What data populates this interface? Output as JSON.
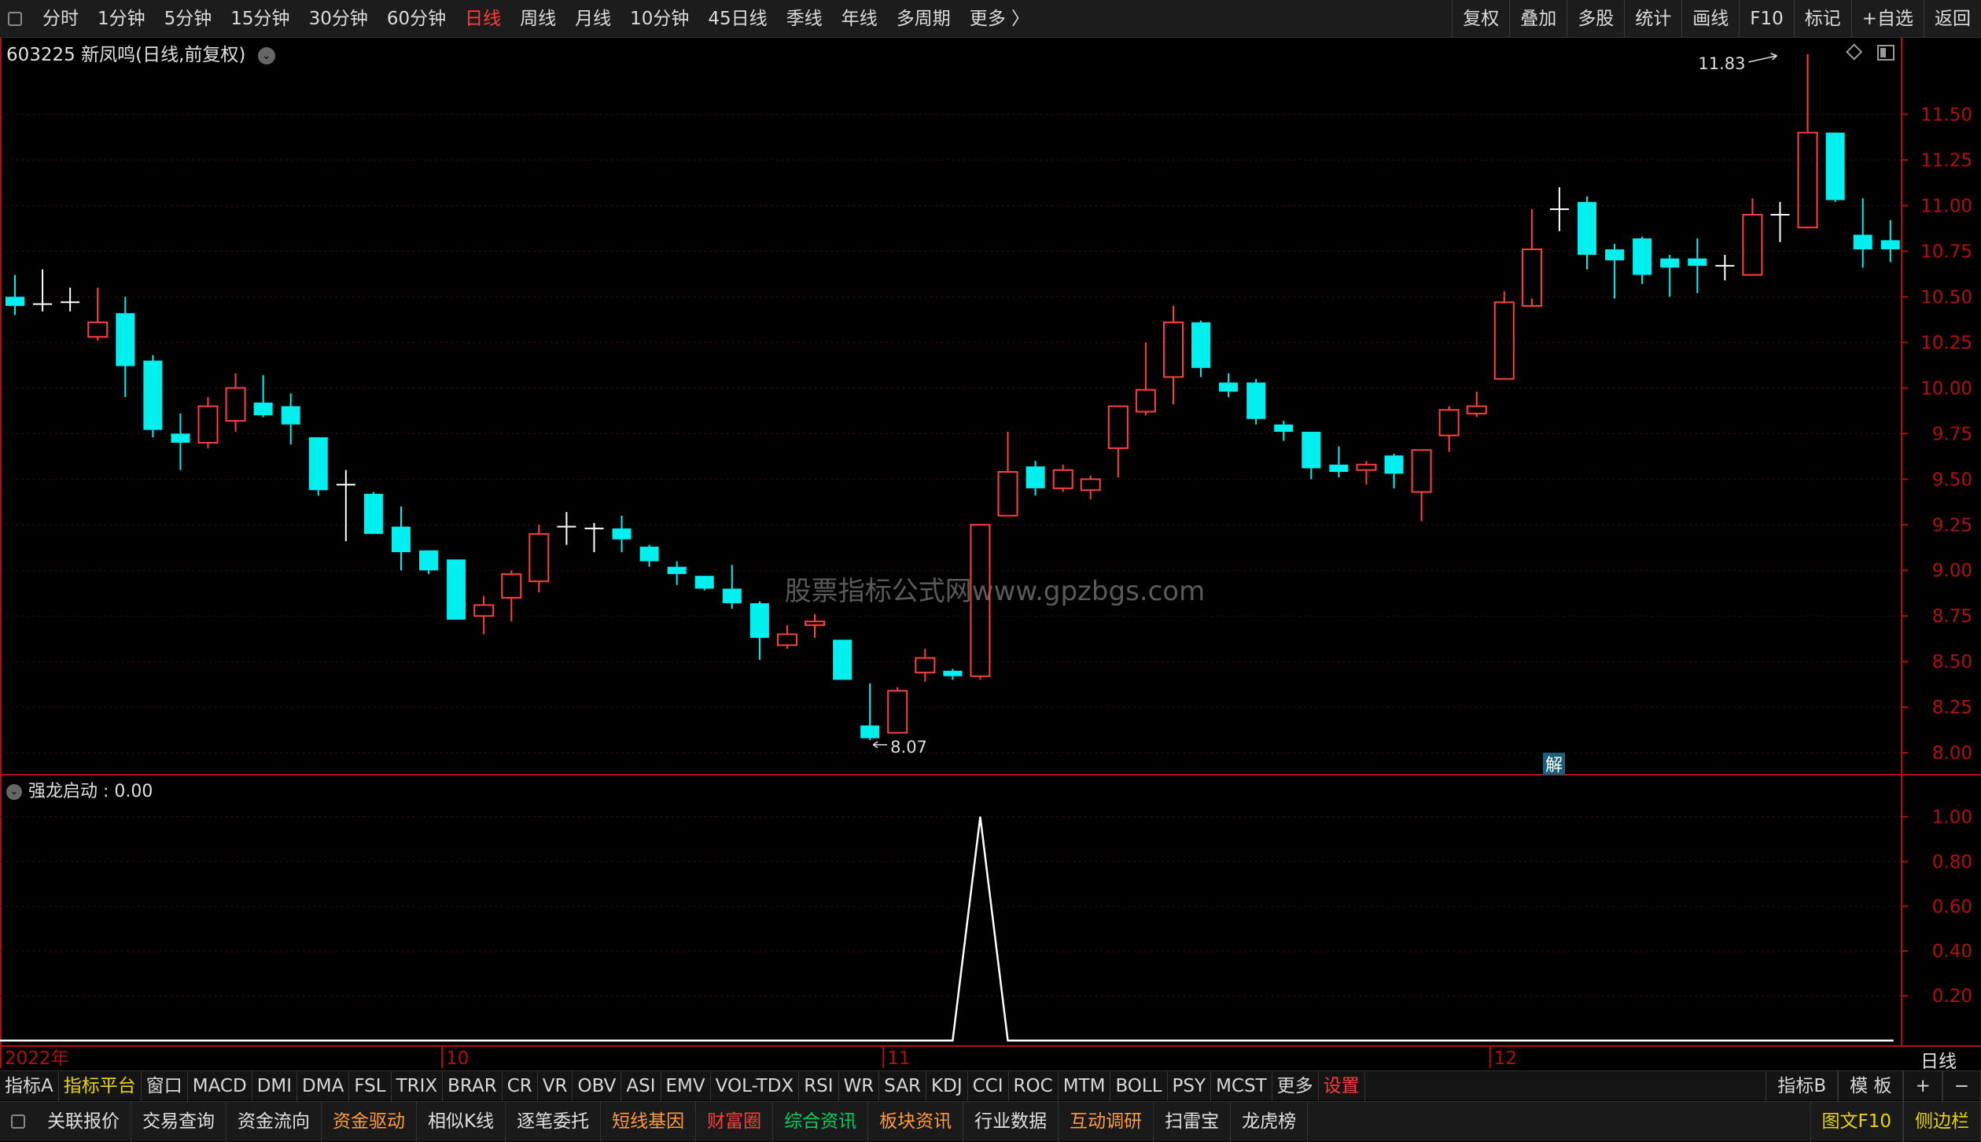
{
  "topbar": {
    "periods": [
      "分时",
      "1分钟",
      "5分钟",
      "15分钟",
      "30分钟",
      "60分钟",
      "日线",
      "周线",
      "月线",
      "10分钟",
      "45日线",
      "季线",
      "年线",
      "多周期",
      "更多 〉"
    ],
    "active_index": 6,
    "tools": [
      "复权",
      "叠加",
      "多股",
      "统计",
      "画线",
      "F10",
      "标记",
      "+自选",
      "返回"
    ]
  },
  "stock": {
    "code": "603225",
    "name": "新凤鸣",
    "mode": "(日线,前复权)"
  },
  "watermark": "股票指标公式网www.gpzbgs.com",
  "jie_marker": "解",
  "indicator": {
    "name": "强龙启动",
    "value_text": "0.00",
    "yticks": [
      "1.00",
      "0.80",
      "0.60",
      "0.40",
      "0.20"
    ]
  },
  "period_label": "日线",
  "x_labels": [
    {
      "i": 0,
      "text": "2022年"
    },
    {
      "i": 16,
      "text": "10"
    },
    {
      "i": 32,
      "text": "11"
    },
    {
      "i": 54,
      "text": "12"
    }
  ],
  "tabs": [
    "指标A",
    "指标平台",
    "窗口",
    "MACD",
    "DMI",
    "DMA",
    "FSL",
    "TRIX",
    "BRAR",
    "CR",
    "VR",
    "OBV",
    "ASI",
    "EMV",
    "VOL-TDX",
    "RSI",
    "WR",
    "SAR",
    "KDJ",
    "CCI",
    "ROC",
    "MTM",
    "BOLL",
    "PSY",
    "MCST",
    "更多",
    "设置"
  ],
  "tabs_right": [
    "指标B",
    "模 板",
    "+",
    "−"
  ],
  "functions": [
    "关联报价",
    "交易查询",
    "资金流向",
    "资金驱动",
    "相似K线",
    "逐笔委托",
    "短线基因",
    "财富圈",
    "综合资讯",
    "板块资讯",
    "行业数据",
    "互动调研",
    "扫雷宝",
    "龙虎榜"
  ],
  "functions_right": [
    "图文F10",
    "侧边栏"
  ],
  "colors": {
    "up": "#ff4040",
    "down": "#00f0f0",
    "flat": "#ffffff",
    "axis": "#b01010"
  },
  "chart_data": {
    "type": "candlestick",
    "title": "603225 新凤鸣 (日线,前复权)",
    "y_ticks": [
      8.0,
      8.25,
      8.5,
      8.75,
      9.0,
      9.25,
      9.5,
      9.75,
      10.0,
      10.25,
      10.5,
      10.75,
      11.0,
      11.25,
      11.5
    ],
    "ylim": [
      7.88,
      11.92
    ],
    "annotations": [
      {
        "i": 31,
        "value": 8.07,
        "text": "8.07"
      },
      {
        "i": 64,
        "value": 11.83,
        "text": "11.83"
      }
    ],
    "candles": [
      [
        10.5,
        10.45,
        10.62,
        10.4
      ],
      [
        10.46,
        10.46,
        10.65,
        10.42
      ],
      [
        10.47,
        10.47,
        10.55,
        10.42
      ],
      [
        10.28,
        10.36,
        10.55,
        10.26
      ],
      [
        10.41,
        10.12,
        10.5,
        9.95
      ],
      [
        10.15,
        9.77,
        10.18,
        9.73
      ],
      [
        9.75,
        9.7,
        9.86,
        9.55
      ],
      [
        9.7,
        9.9,
        9.95,
        9.67
      ],
      [
        9.82,
        10.0,
        10.08,
        9.76
      ],
      [
        9.92,
        9.85,
        10.07,
        9.84
      ],
      [
        9.9,
        9.8,
        9.97,
        9.69
      ],
      [
        9.73,
        9.44,
        9.73,
        9.41
      ],
      [
        9.47,
        9.47,
        9.55,
        9.16
      ],
      [
        9.42,
        9.2,
        9.43,
        9.2
      ],
      [
        9.24,
        9.1,
        9.35,
        9.0
      ],
      [
        9.11,
        9.0,
        9.11,
        8.98
      ],
      [
        9.06,
        8.73,
        9.06,
        8.73
      ],
      [
        8.75,
        8.81,
        8.86,
        8.65
      ],
      [
        8.85,
        8.98,
        9.0,
        8.72
      ],
      [
        8.94,
        9.2,
        9.25,
        8.88
      ],
      [
        9.24,
        9.24,
        9.32,
        9.14
      ],
      [
        9.23,
        9.23,
        9.26,
        9.1
      ],
      [
        9.23,
        9.17,
        9.3,
        9.1
      ],
      [
        9.13,
        9.05,
        9.14,
        9.02
      ],
      [
        9.02,
        8.98,
        9.05,
        8.92
      ],
      [
        8.97,
        8.9,
        8.97,
        8.89
      ],
      [
        8.9,
        8.82,
        9.03,
        8.79
      ],
      [
        8.82,
        8.63,
        8.83,
        8.51
      ],
      [
        8.59,
        8.65,
        8.7,
        8.57
      ],
      [
        8.7,
        8.72,
        8.76,
        8.63
      ],
      [
        8.62,
        8.4,
        8.62,
        8.4
      ],
      [
        8.15,
        8.08,
        8.38,
        8.07
      ],
      [
        8.11,
        8.34,
        8.36,
        8.11
      ],
      [
        8.44,
        8.52,
        8.57,
        8.39
      ],
      [
        8.45,
        8.42,
        8.46,
        8.4
      ],
      [
        8.42,
        9.25,
        9.25,
        8.4
      ],
      [
        9.3,
        9.54,
        9.76,
        9.3
      ],
      [
        9.57,
        9.45,
        9.6,
        9.41
      ],
      [
        9.45,
        9.55,
        9.58,
        9.43
      ],
      [
        9.44,
        9.5,
        9.52,
        9.39
      ],
      [
        9.67,
        9.9,
        9.9,
        9.51
      ],
      [
        9.87,
        9.99,
        10.25,
        9.85
      ],
      [
        10.06,
        10.36,
        10.45,
        9.91
      ],
      [
        10.36,
        10.11,
        10.37,
        10.06
      ],
      [
        10.03,
        9.98,
        10.08,
        9.95
      ],
      [
        10.03,
        9.83,
        10.05,
        9.8
      ],
      [
        9.8,
        9.76,
        9.82,
        9.71
      ],
      [
        9.76,
        9.56,
        9.76,
        9.5
      ],
      [
        9.58,
        9.54,
        9.68,
        9.51
      ],
      [
        9.55,
        9.58,
        9.6,
        9.47
      ],
      [
        9.63,
        9.53,
        9.64,
        9.45
      ],
      [
        9.43,
        9.66,
        9.66,
        9.27
      ],
      [
        9.74,
        9.88,
        9.9,
        9.65
      ],
      [
        9.86,
        9.9,
        9.98,
        9.84
      ],
      [
        10.05,
        10.47,
        10.53,
        10.05
      ],
      [
        10.45,
        10.76,
        10.98,
        10.49
      ],
      [
        10.98,
        10.98,
        11.1,
        10.86
      ],
      [
        11.02,
        10.73,
        11.05,
        10.65
      ],
      [
        10.76,
        10.7,
        10.79,
        10.49
      ],
      [
        10.82,
        10.62,
        10.83,
        10.57
      ],
      [
        10.71,
        10.66,
        10.73,
        10.5
      ],
      [
        10.71,
        10.67,
        10.82,
        10.52
      ],
      [
        10.67,
        10.67,
        10.73,
        10.59
      ],
      [
        10.62,
        10.95,
        11.04,
        10.62
      ],
      [
        10.95,
        10.95,
        11.02,
        10.8
      ],
      [
        10.88,
        11.4,
        11.83,
        10.88
      ],
      [
        11.4,
        11.03,
        11.4,
        11.02
      ],
      [
        10.84,
        10.76,
        11.04,
        10.66
      ],
      [
        10.81,
        10.76,
        10.92,
        10.69
      ]
    ],
    "indicator_series": {
      "name": "强龙启动",
      "ylim": [
        0,
        1.1
      ],
      "spike_i": 35,
      "spike_value": 1.0,
      "baseline": 0
    }
  }
}
